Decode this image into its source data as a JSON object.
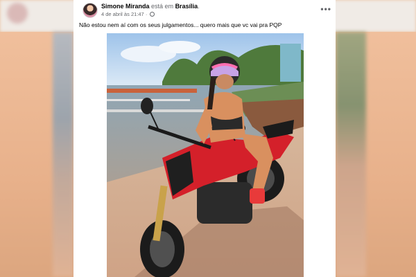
{
  "post": {
    "author": "Simone Miranda",
    "status_word": "está em",
    "location": "Brasília",
    "location_suffix": ".",
    "date": "4 de abril às 21:47",
    "separator": "·",
    "privacy_icon": "globe-icon",
    "more_label": "•••",
    "text": "Não estou nem aí com os seus julgamentos... quero mais que vc vai pra PQP"
  },
  "colors": {
    "page_background": "#e9c3a3",
    "card_background": "#ffffff",
    "author_text": "#050505",
    "meta_text": "#65676b",
    "motorcycle_red": "#d4202a"
  },
  "photo": {
    "icon": "photo-image"
  }
}
